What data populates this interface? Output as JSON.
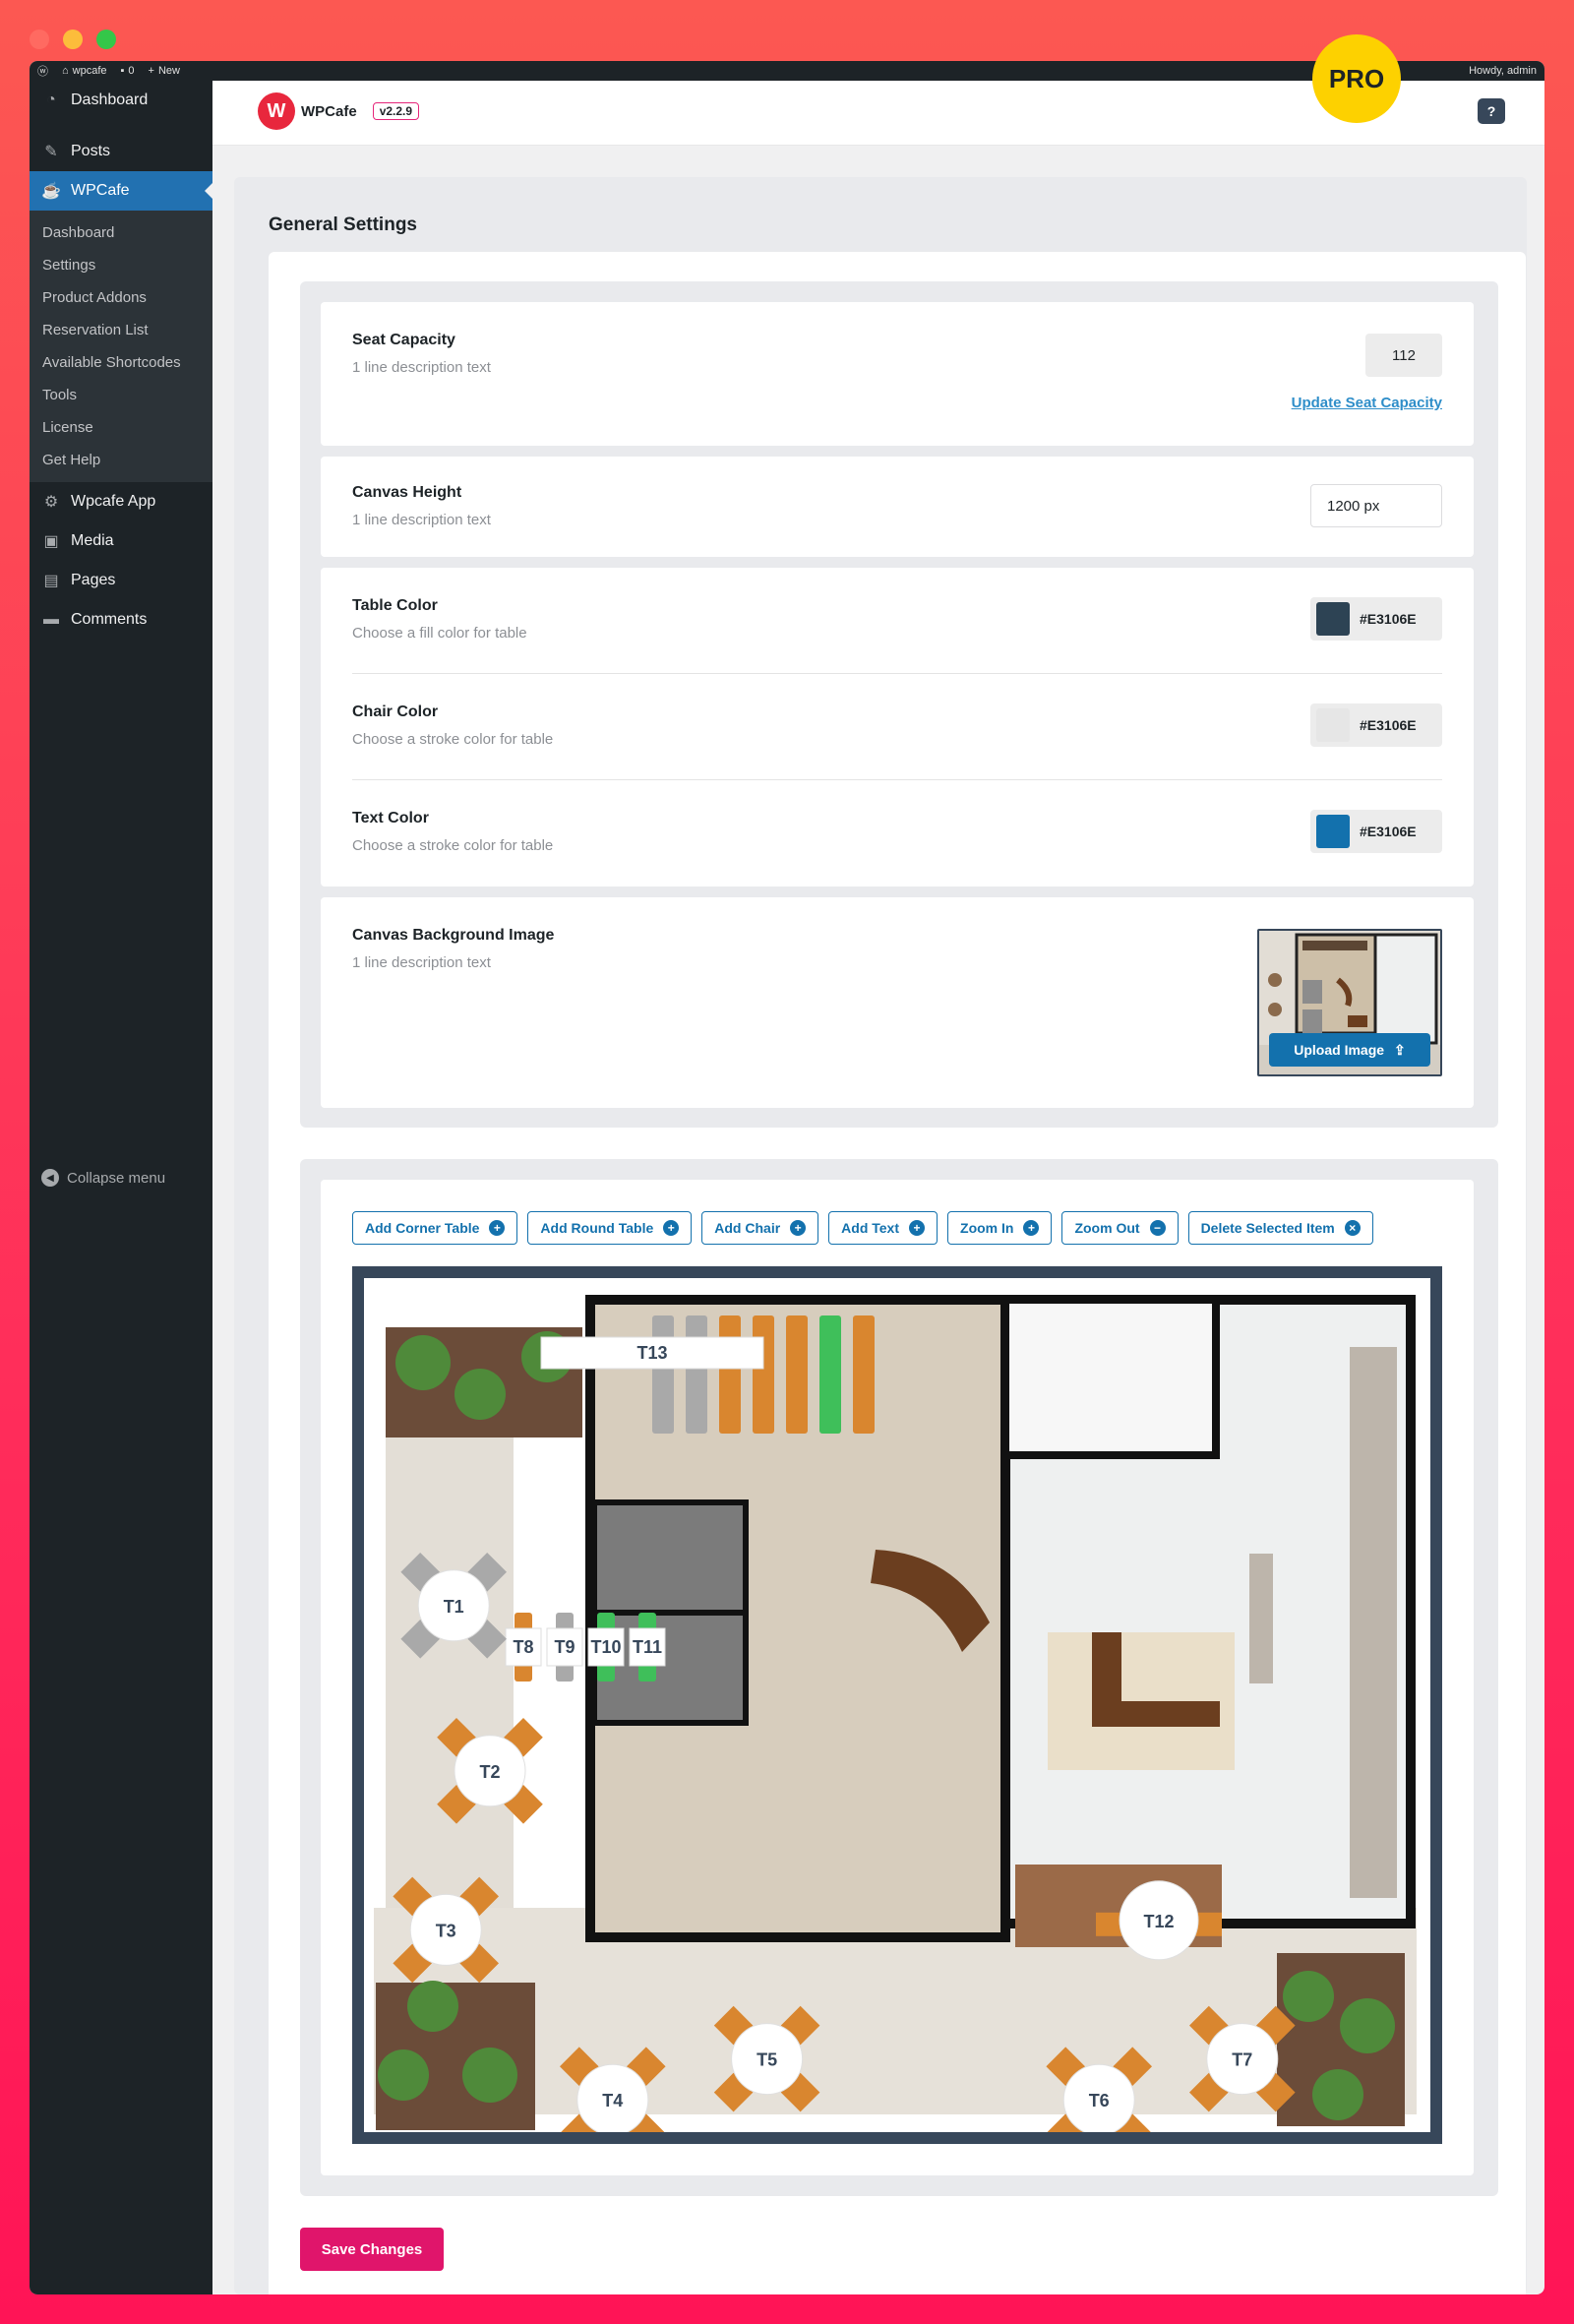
{
  "badge": {
    "text": "PRO"
  },
  "adminbar": {
    "site": "wpcafe",
    "comments": "0",
    "new": "New",
    "howdy": "Howdy, admin"
  },
  "sidebar": {
    "items_top": [
      {
        "label": "Dashboard",
        "icon": "dashboard-icon"
      },
      {
        "label": "Posts",
        "icon": "pin-icon"
      },
      {
        "label": "WPCafe",
        "icon": "wpcafe-icon"
      }
    ],
    "submenu": [
      "Dashboard",
      "Settings",
      "Product Addons",
      "Reservation List",
      "Available Shortcodes",
      "Tools",
      "License",
      "Get Help"
    ],
    "items_bottom": [
      {
        "label": "Wpcafe App",
        "icon": "gear-icon"
      },
      {
        "label": "Media",
        "icon": "media-icon"
      },
      {
        "label": "Pages",
        "icon": "pages-icon"
      },
      {
        "label": "Comments",
        "icon": "comment-icon"
      }
    ],
    "collapse": "Collapse menu"
  },
  "header": {
    "logo": "WPCafe",
    "version": "v2.2.9",
    "help": "?"
  },
  "page": {
    "title": "General Settings"
  },
  "settings": {
    "seat_capacity": {
      "label": "Seat Capacity",
      "desc": "1 line description text",
      "value": "112",
      "link": "Update Seat Capacity"
    },
    "canvas_height": {
      "label": "Canvas Height",
      "desc": "1 line description text",
      "value": "1200 px"
    },
    "table_color": {
      "label": "Table Color",
      "desc": "Choose a fill color for table",
      "value": "#E3106E",
      "swatch": "#2d4354"
    },
    "chair_color": {
      "label": "Chair Color",
      "desc": "Choose a stroke color for table",
      "value": "#E3106E",
      "swatch": "#e6e6e6"
    },
    "text_color": {
      "label": "Text Color",
      "desc": "Choose a stroke color for table",
      "value": "#E3106E",
      "swatch": "#1371ad"
    },
    "canvas_bg": {
      "label": "Canvas Background Image",
      "desc": "1 line description text",
      "upload": "Upload Image"
    }
  },
  "toolbar": {
    "add_corner_table": "Add Corner Table",
    "add_round_table": "Add Round Table",
    "add_chair": "Add Chair",
    "add_text": "Add Text",
    "zoom_in": "Zoom In",
    "zoom_out": "Zoom Out",
    "delete_selected": "Delete Selected Item"
  },
  "floorplan": {
    "banquet": {
      "label": "T13",
      "chairs": [
        "gray",
        "gray",
        "orange",
        "orange",
        "orange",
        "green",
        "orange"
      ]
    },
    "tables": [
      {
        "label": "T1",
        "shape": "round"
      },
      {
        "label": "T2",
        "shape": "round"
      },
      {
        "label": "T3",
        "shape": "round"
      },
      {
        "label": "T4",
        "shape": "round"
      },
      {
        "label": "T5",
        "shape": "round"
      },
      {
        "label": "T6",
        "shape": "round"
      },
      {
        "label": "T7",
        "shape": "round"
      },
      {
        "label": "T8",
        "shape": "square",
        "chair": "orange"
      },
      {
        "label": "T9",
        "shape": "square",
        "chair": "gray"
      },
      {
        "label": "T10",
        "shape": "square",
        "chair": "green"
      },
      {
        "label": "T11",
        "shape": "square",
        "chair": "green"
      },
      {
        "label": "T12",
        "shape": "round"
      }
    ],
    "colors": {
      "orange": "#d9862f",
      "gray": "#a9a9a9",
      "green": "#3fbf5a"
    }
  },
  "actions": {
    "save": "Save Changes"
  }
}
